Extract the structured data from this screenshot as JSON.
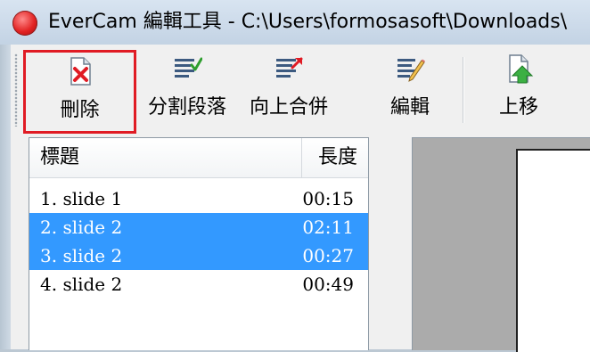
{
  "window": {
    "title": "EverCam 編輯工具 - C:\\Users\\formosasoft\\Downloads\\"
  },
  "toolbar": {
    "buttons": [
      {
        "label": "刪除",
        "icon": "delete-document-icon",
        "selected": true
      },
      {
        "label": "分割段落",
        "icon": "split-paragraph-icon"
      },
      {
        "label": "向上合併",
        "icon": "merge-up-icon"
      },
      {
        "label": "編輯",
        "icon": "edit-pencil-icon"
      },
      {
        "label": "上移",
        "icon": "move-up-arrow-icon"
      }
    ]
  },
  "list": {
    "columns": {
      "title": "標題",
      "length": "長度"
    },
    "rows": [
      {
        "title": "1. slide 1",
        "length": "00:15",
        "selected": false
      },
      {
        "title": "2. slide 2",
        "length": "02:11",
        "selected": true
      },
      {
        "title": "3. slide 2",
        "length": "00:27",
        "selected": true
      },
      {
        "title": "4. slide 2",
        "length": "00:49",
        "selected": false
      }
    ]
  },
  "colors": {
    "selection": "#3399ff",
    "highlight_border": "#e01b24",
    "preview_background": "#ababab"
  }
}
